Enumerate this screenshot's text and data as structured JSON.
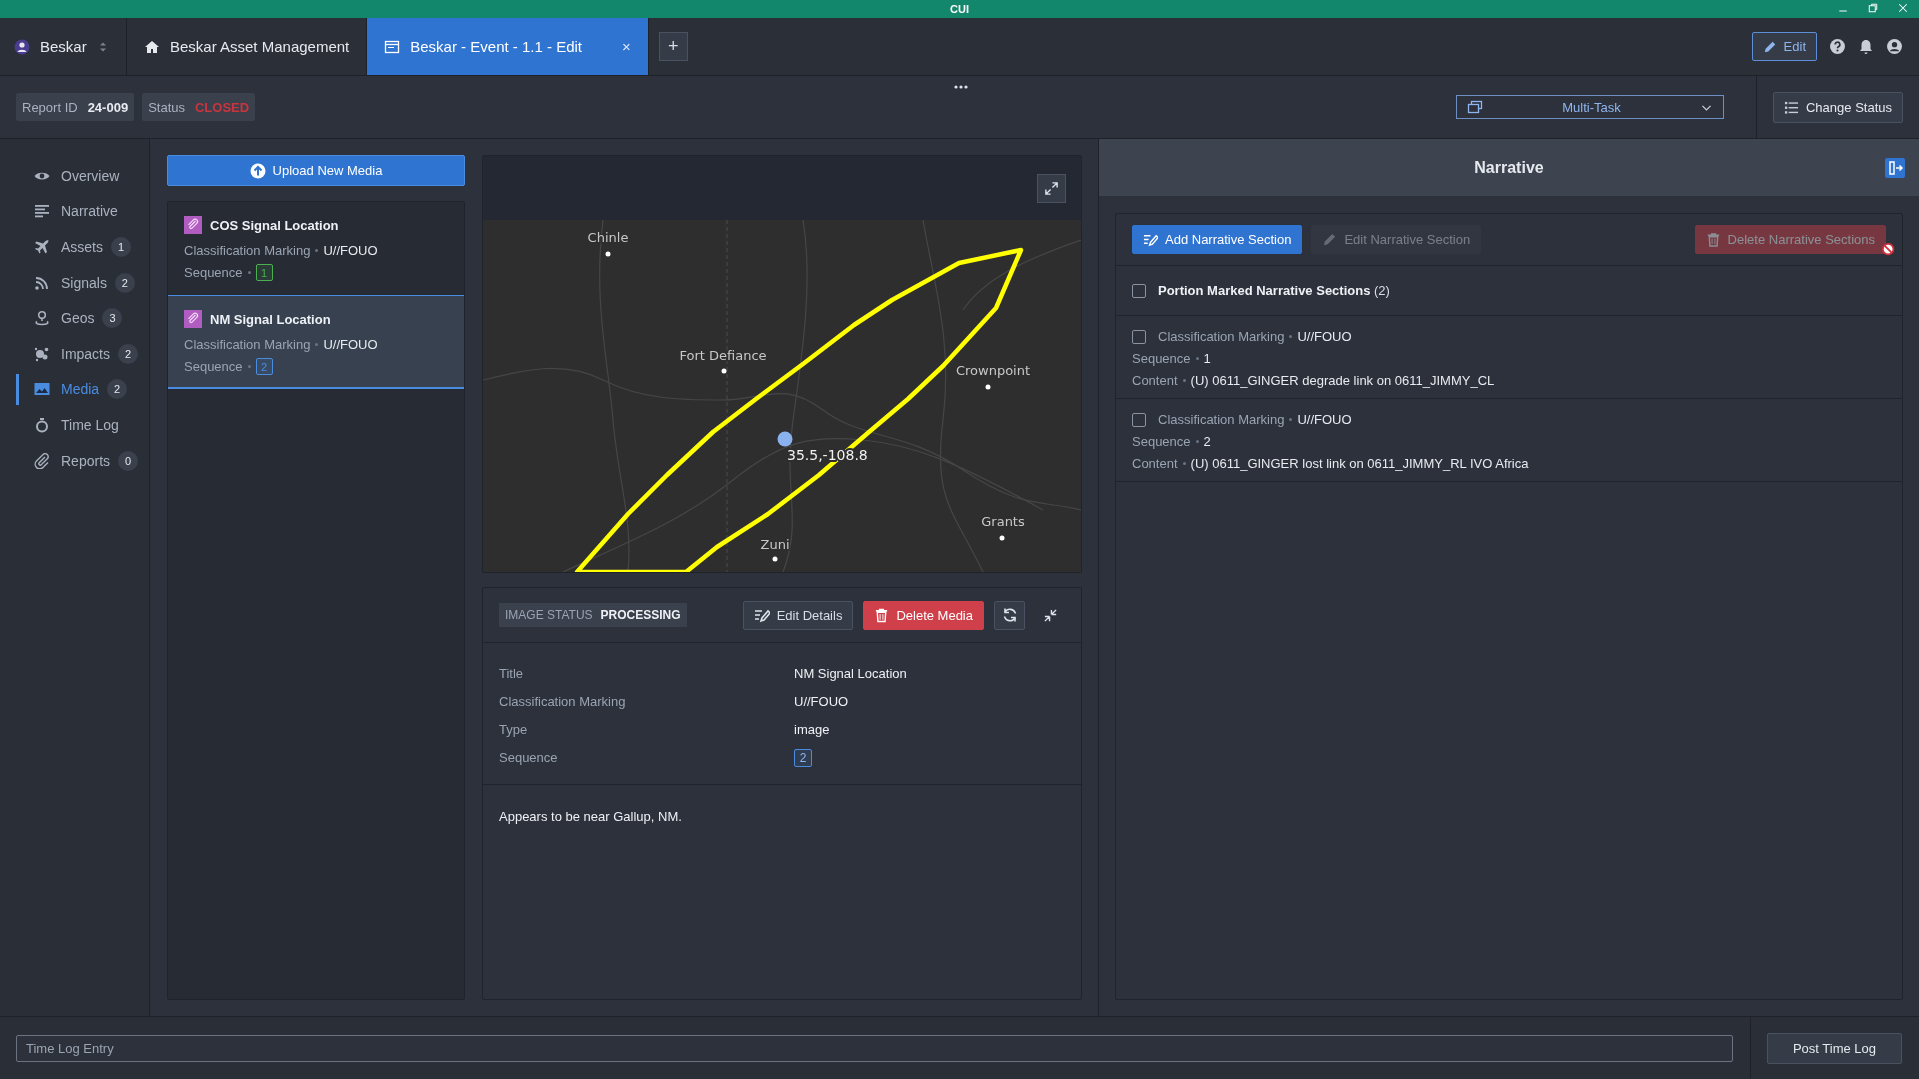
{
  "system_banner": "CUI",
  "app_switcher": {
    "label": "Beskar"
  },
  "tabs": [
    {
      "label": "Beskar Asset Management",
      "selected": false
    },
    {
      "label": "Beskar - Event - 1.1 - Edit",
      "selected": true,
      "close": "×"
    }
  ],
  "new_tab": "+",
  "header_actions": {
    "edit": "Edit"
  },
  "report": {
    "id_label": "Report ID",
    "id": "24-009",
    "status_label": "Status",
    "status": "CLOSED"
  },
  "view_select": {
    "value": "Multi-Task"
  },
  "change_status": "Change Status",
  "nav": [
    {
      "label": "Overview",
      "selected": false
    },
    {
      "label": "Narrative",
      "selected": false
    },
    {
      "label": "Assets",
      "count": "1",
      "selected": false
    },
    {
      "label": "Signals",
      "count": "2",
      "selected": false
    },
    {
      "label": "Geos",
      "count": "3",
      "selected": false
    },
    {
      "label": "Impacts",
      "count": "2",
      "selected": false
    },
    {
      "label": "Media",
      "count": "2",
      "selected": true
    },
    {
      "label": "Time Log",
      "selected": false
    },
    {
      "label": "Reports",
      "count": "0",
      "selected": false
    }
  ],
  "media": {
    "upload": "Upload New Media",
    "items": [
      {
        "title": "COS Signal Location",
        "marking_label": "Classification Marking",
        "marking": "U//FOUO",
        "sequence_label": "Sequence",
        "sequence": "1",
        "color": "#4caf50",
        "selected": false
      },
      {
        "title": "NM Signal Location",
        "marking_label": "Classification Marking",
        "marking": "U//FOUO",
        "sequence_label": "Sequence",
        "sequence": "2",
        "color": "#4a8de0",
        "selected": true
      }
    ]
  },
  "map": {
    "labels": [
      "Chinle",
      "Fort Defiance",
      "Crownpoint",
      "Zuni",
      "Grants"
    ],
    "coordinate": "35.5,-108.8"
  },
  "details": {
    "image_status_label": "IMAGE STATUS",
    "image_status": "PROCESSING",
    "edit": "Edit Details",
    "delete": "Delete Media",
    "fields": [
      {
        "label": "Title",
        "value": "NM Signal Location",
        "kind": "text"
      },
      {
        "label": "Classification Marking",
        "value": "U//FOUO",
        "kind": "text"
      },
      {
        "label": "Type",
        "value": "image",
        "kind": "text"
      },
      {
        "label": "Sequence",
        "value": "2",
        "kind": "badge"
      }
    ],
    "description": "Appears to be near Gallup, NM."
  },
  "narrative": {
    "title": "Narrative",
    "actions": [
      {
        "label": "Add Narrative Section",
        "kind": "primary",
        "disabled": false
      },
      {
        "label": "Edit Narrative Section",
        "kind": "secondary",
        "disabled": true
      },
      {
        "label": "Delete Narrative Sections",
        "kind": "danger",
        "disabled": true
      }
    ],
    "select_all": {
      "label": "Portion Marked Narrative Sections",
      "count": "(2)",
      "checked": false
    },
    "sections": [
      {
        "marking_label": "Classification Marking",
        "marking": "U//FOUO",
        "sequence_label": "Sequence",
        "sequence": "1",
        "content_label": "Content",
        "content": "(U) 0611_GINGER degrade link on 0611_JIMMY_CL",
        "checked": false
      },
      {
        "marking_label": "Classification Marking",
        "marking": "U//FOUO",
        "sequence_label": "Sequence",
        "sequence": "2",
        "content_label": "Content",
        "content": "(U) 0611_GINGER lost link on 0611_JIMMY_RL IVO Africa",
        "checked": false
      }
    ]
  },
  "time_log": {
    "placeholder": "Time Log Entry",
    "button": "Post Time Log"
  }
}
